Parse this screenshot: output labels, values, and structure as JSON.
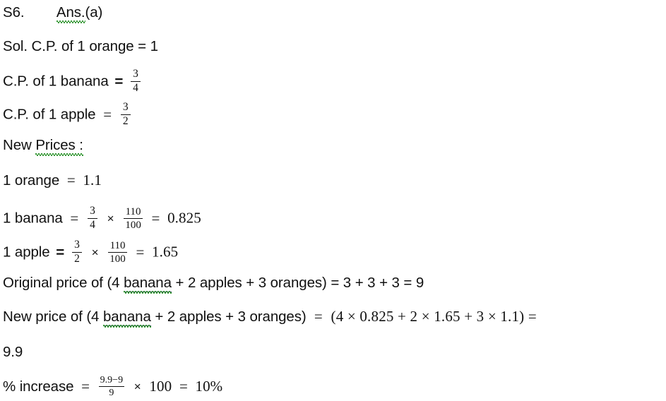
{
  "document": {
    "background_color": "#ffffff",
    "text_color": "#111111",
    "squiggle_color": "#3a9a3a",
    "underline_color": "#1b2b4a"
  },
  "lines": {
    "l1": {
      "label": "S6.",
      "answer": "Ans.",
      "answer_option": "(a)"
    },
    "l2": {
      "text": "Sol. C.P. of 1 orange = 1"
    },
    "l3": {
      "text": "C.P. of 1 banana",
      "equals": "=",
      "frac_num": "3",
      "frac_den": "4"
    },
    "l4": {
      "text": "C.P. of 1 apple",
      "equals": "=",
      "frac_num": "3",
      "frac_den": "2"
    },
    "l5": {
      "prefix": "New ",
      "heading": "Prices :"
    },
    "l6": {
      "text": "1 orange",
      "equals": "=",
      "value": "1.1"
    },
    "l7": {
      "text": "1 banana",
      "equals": "=",
      "f1_num": "3",
      "f1_den": "4",
      "times": "×",
      "f2_num": "110",
      "f2_den": "100",
      "equals2": "=",
      "value": "0.825"
    },
    "l8": {
      "text": "1 apple",
      "equals": "=",
      "f1_num": "3",
      "f1_den": "2",
      "times": "×",
      "f2_num": "110",
      "f2_den": "100",
      "equals2": "=",
      "value": "1.65"
    },
    "l9": {
      "part1": "Original price of (4 ",
      "banana": "banana",
      "part2": " + 2 apples + 3 oranges) = 3 + 3 + 3 = 9"
    },
    "l10": {
      "part1": "New price of (4 ",
      "banana": "banana",
      "part2": " + 2 apples + 3 oranges)",
      "equals": "=",
      "expression": "(4 × 0.825 + 2 × 1.65 + 3 × 1.1) ="
    },
    "l11": {
      "text": "9.9"
    },
    "l12": {
      "text": "% increase",
      "equals": "=",
      "frac_num": "9.9−9",
      "frac_den": "9",
      "times": "×",
      "hundred": "100",
      "equals2": "=",
      "result": "10%"
    }
  }
}
